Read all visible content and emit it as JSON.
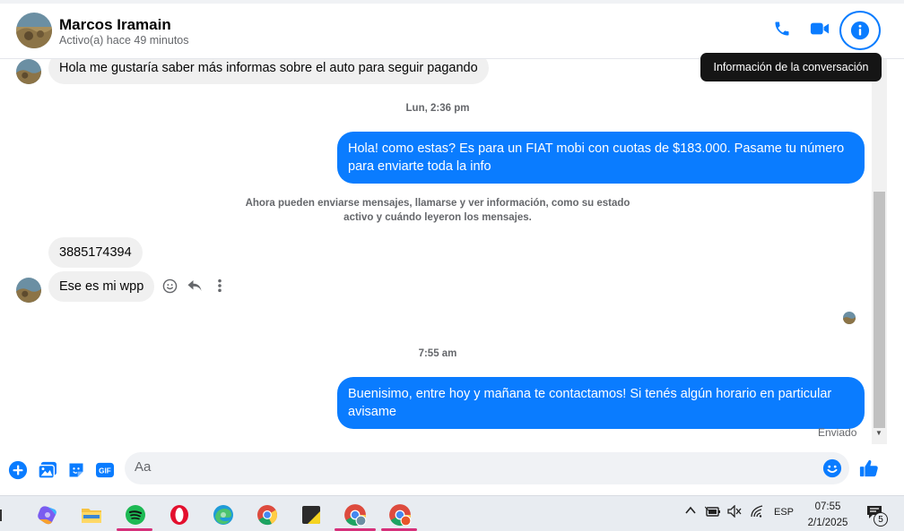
{
  "header": {
    "contact_name": "Marcos Iramain",
    "status": "Activo(a) hace 49 minutos",
    "tooltip": "Información de la conversación"
  },
  "messages": {
    "incoming_top": "Hola me gustaría saber más informas sobre el auto para seguir pagando",
    "ts_1": "Lun, 2:36 pm",
    "outgoing_1": "Hola! como estas? Es para un FIAT mobi con cuotas de $183.000. Pasame tu número para enviarte toda la info",
    "notice": "Ahora pueden enviarse mensajes, llamarse y ver información, como su estado activo y cuándo leyeron los mensajes.",
    "incoming_phone": "3885174394",
    "incoming_wpp": "Ese es mi wpp",
    "ts_2": "7:55 am",
    "outgoing_2": "Buenisimo, entre hoy y mañana te contactamos! Si tenés algún horario en particular avisame",
    "sent_status": "Enviado"
  },
  "composer": {
    "placeholder": "Aa"
  },
  "taskbar": {
    "language": "ESP",
    "time": "07:55",
    "date": "2/1/2025",
    "notification_count": "5"
  },
  "colors": {
    "accent": "#0a7cff",
    "incoming_bubble": "#f0f0f0"
  }
}
